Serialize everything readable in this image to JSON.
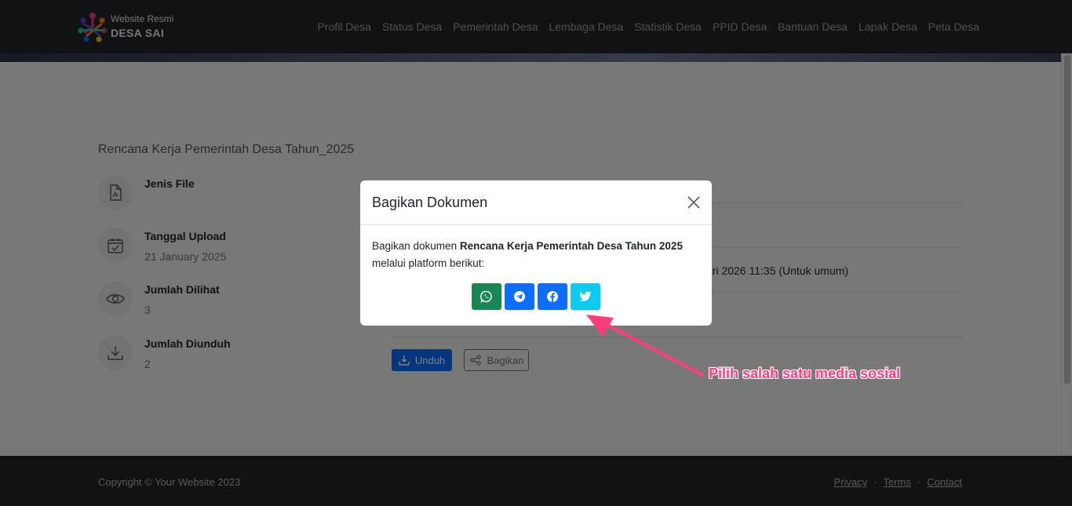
{
  "brand": {
    "small": "Website Resmi",
    "name": "DESA SAI"
  },
  "nav": [
    "Profil Desa",
    "Status Desa",
    "Pemerintah Desa",
    "Lembaga Desa",
    "Statistik Desa",
    "PPID Desa",
    "Bantuan Desa",
    "Lapak Desa",
    "Peta Desa"
  ],
  "document": {
    "title": "Rencana Kerja Pemerintah Desa Tahun_2025",
    "info": {
      "jenis_file": {
        "label": "Jenis File",
        "value": ""
      },
      "tanggal_upload": {
        "label": "Tanggal Upload",
        "value": "21 January 2025"
      },
      "jumlah_dilihat": {
        "label": "Jumlah Dilihat",
        "value": "3"
      },
      "jumlah_diunduh": {
        "label": "Jumlah Diunduh",
        "value": "2"
      }
    },
    "visible_detail": "ari 2026 11:35 (Untuk umum)"
  },
  "actions": {
    "download": "Unduh",
    "share": "Bagikan"
  },
  "modal": {
    "title": "Bagikan Dokumen",
    "body_prefix": "Bagikan dokumen ",
    "doc_name": "Rencana Kerja Pemerintah Desa Tahun 2025",
    "body_suffix": "melalui platform berikut:",
    "share_buttons": [
      "whatsapp-icon",
      "telegram-icon",
      "facebook-icon",
      "twitter-icon"
    ]
  },
  "annotation": {
    "text": "Pilih salah satu media sosial"
  },
  "footer": {
    "copyright": "Copyright © Your Website 2023",
    "links": [
      "Privacy",
      "Terms",
      "Contact"
    ],
    "separator": "·"
  },
  "colors": {
    "navbar": "#212529",
    "primary": "#0d6efd",
    "whatsapp": "#198754",
    "twitter": "#0dcaf0",
    "annotation": "#ff3d7a"
  }
}
